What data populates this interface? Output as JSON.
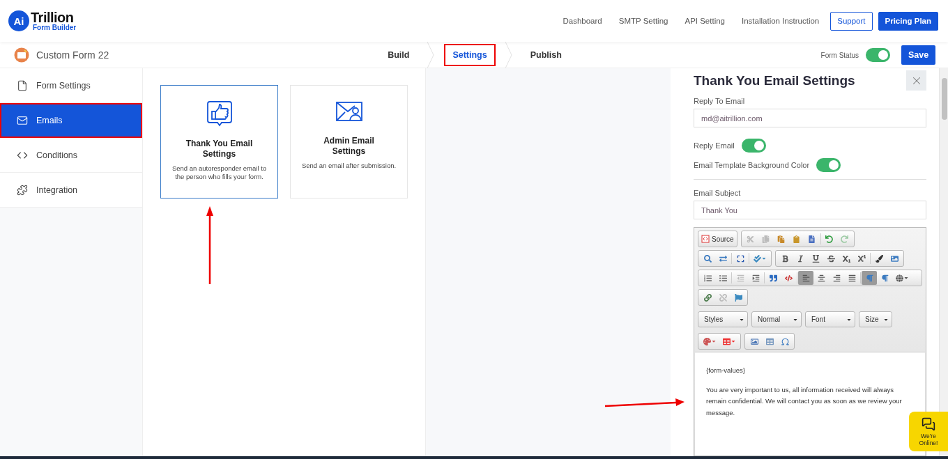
{
  "logo": {
    "mark": "Ai",
    "name": "Trillion",
    "tagline": "Form Builder"
  },
  "nav": [
    "Dashboard",
    "SMTP Setting",
    "API Setting",
    "Installation Instruction"
  ],
  "header_buttons": [
    {
      "label": "Support",
      "kind": "outline"
    },
    {
      "label": "Pricing Plan",
      "kind": "primary"
    }
  ],
  "form": {
    "name": "Custom Form 22"
  },
  "steps": [
    {
      "label": "Build",
      "selected": false
    },
    {
      "label": "Settings",
      "selected": true
    },
    {
      "label": "Publish",
      "selected": false
    }
  ],
  "form_status": {
    "label": "Form Status",
    "on": true
  },
  "save_button": "Save",
  "sidebar": [
    {
      "label": "Form Settings",
      "selected": false
    },
    {
      "label": "Emails",
      "selected": true
    },
    {
      "label": "Conditions",
      "selected": false
    },
    {
      "label": "Integration",
      "selected": false
    }
  ],
  "email_cards": [
    {
      "title": "Thank You Email Settings",
      "description": "Send an autoresponder email to the person who fills your form.",
      "selected": true
    },
    {
      "title": "Admin Email Settings",
      "description": "Send an email after submission.",
      "selected": false
    }
  ],
  "panel": {
    "title": "Thank You Email Settings",
    "reply_to": {
      "label": "Reply To Email",
      "value": "md@aitrillion.com"
    },
    "toggles": [
      {
        "label": "Reply Email",
        "on": true
      },
      {
        "label": "Email Template Background Color",
        "on": true
      }
    ],
    "subject": {
      "label": "Email Subject",
      "value": "Thank You"
    },
    "editor": {
      "source_button": "Source",
      "combos": [
        "Styles",
        "Normal",
        "Font",
        "Size"
      ],
      "align_buttons": [
        {
          "selected": true
        },
        {
          "selected": false
        },
        {
          "selected": false
        },
        {
          "selected": false
        }
      ],
      "direction_buttons": [
        {
          "selected": true
        },
        {
          "selected": false
        }
      ],
      "content": [
        "{form-values}",
        "You are very important to us, all information received will always remain confidential. We will contact you as soon as we review your message."
      ]
    }
  },
  "chat_widget": {
    "label": "We're Online!"
  }
}
